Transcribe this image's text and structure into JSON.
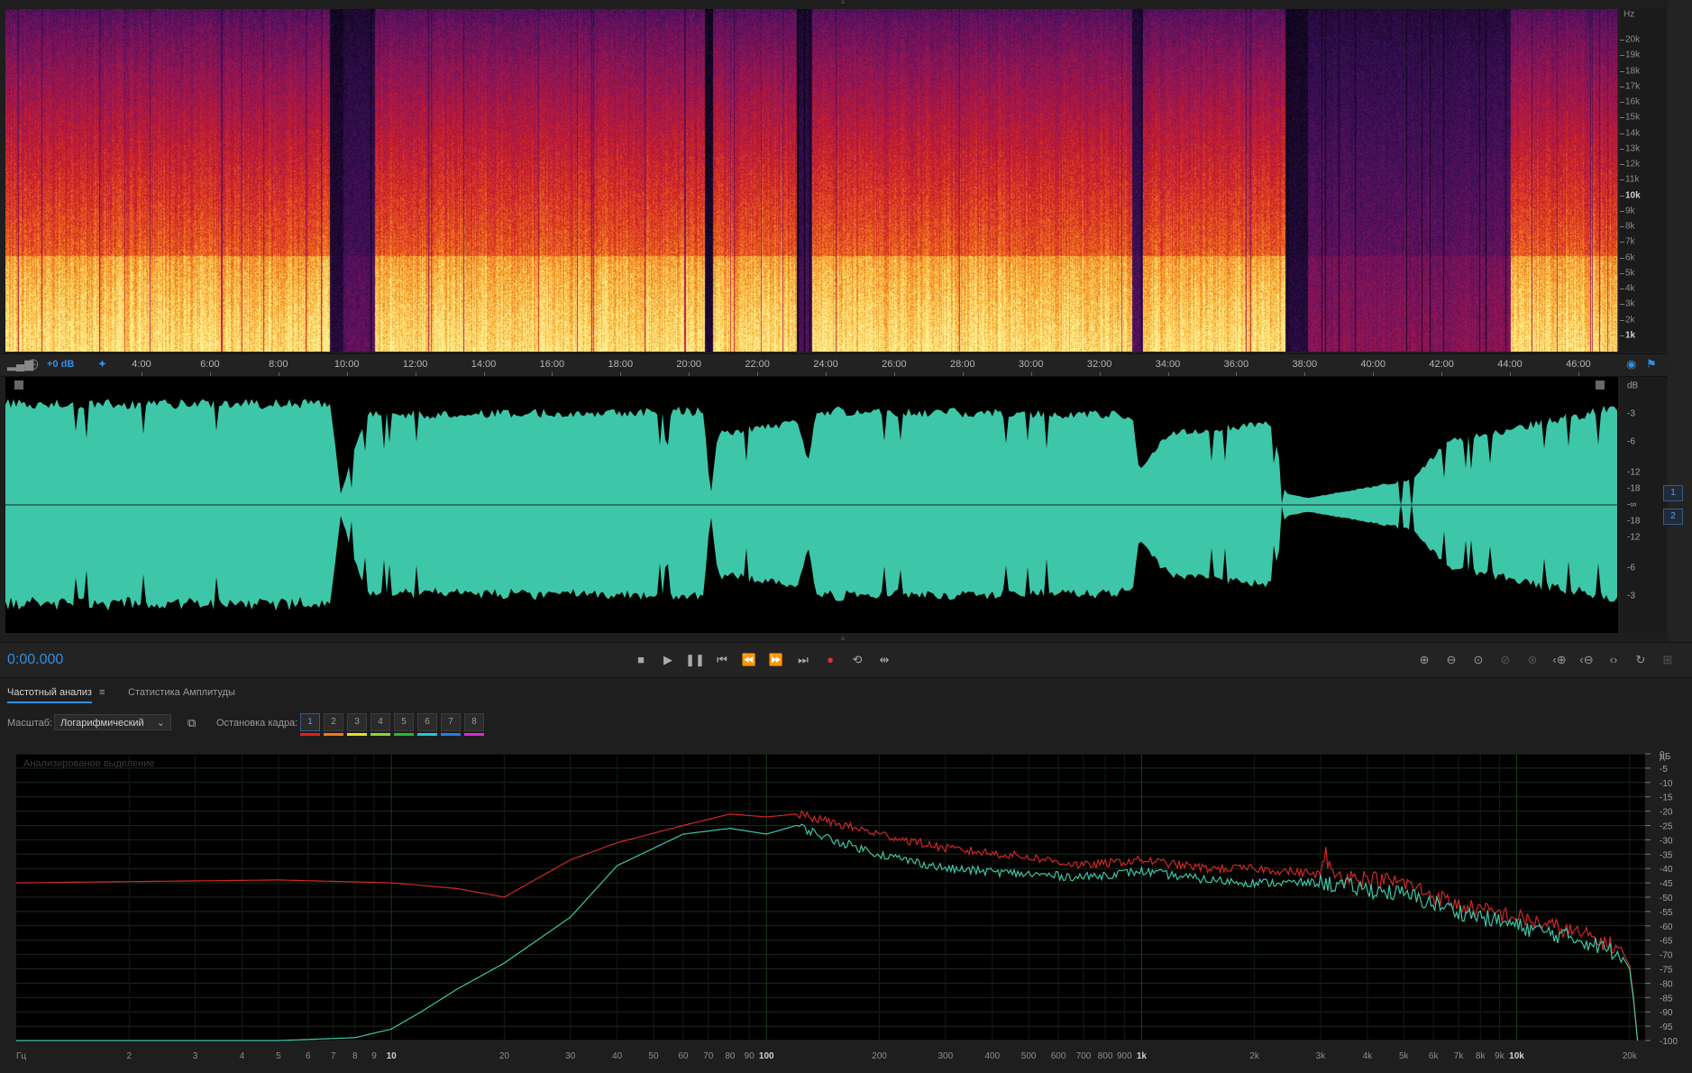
{
  "spectrogram": {
    "unit": "Hz",
    "freq_labels": [
      "20k",
      "19k",
      "18k",
      "17k",
      "16k",
      "15k",
      "14k",
      "13k",
      "12k",
      "11k",
      "10k",
      "9k",
      "8k",
      "7k",
      "6k",
      "5k",
      "4k",
      "3k",
      "2k",
      "1k"
    ]
  },
  "time_ruler": {
    "db_readout": "+0 dB",
    "labels": [
      "4:00",
      "6:00",
      "8:00",
      "10:00",
      "12:00",
      "14:00",
      "16:00",
      "18:00",
      "20:00",
      "22:00",
      "24:00",
      "26:00",
      "28:00",
      "30:00",
      "32:00",
      "34:00",
      "36:00",
      "38:00",
      "40:00",
      "42:00",
      "44:00",
      "46:00"
    ]
  },
  "waveform": {
    "unit": "dB",
    "db_labels": [
      "-3",
      "-6",
      "-12",
      "-18",
      "-∞",
      "-18",
      "-12",
      "-6",
      "-3"
    ],
    "channels": [
      "1",
      "2"
    ],
    "color": "#3ec6a8",
    "peak_color": "#4a6ad8"
  },
  "transport": {
    "timecode": "0:00.000",
    "buttons": [
      "stop",
      "play",
      "pause",
      "go-to-start",
      "rewind",
      "fast-forward",
      "go-to-end",
      "record",
      "loop",
      "skip-selection"
    ]
  },
  "panel": {
    "tabs": [
      {
        "label": "Частотный анализ",
        "active": true
      },
      {
        "label": "Статистика Амплитуды",
        "active": false
      }
    ],
    "scale_label": "Масштаб:",
    "scale_value": "Логарифмический",
    "freeze_label": "Остановка кадра:",
    "frames": [
      {
        "label": "1",
        "color": "#e02020"
      },
      {
        "label": "2",
        "color": "#f07a1a"
      },
      {
        "label": "3",
        "color": "#e8e020"
      },
      {
        "label": "4",
        "color": "#8ad82a"
      },
      {
        "label": "5",
        "color": "#2ab830"
      },
      {
        "label": "6",
        "color": "#20c8d8"
      },
      {
        "label": "7",
        "color": "#2a7ae8"
      },
      {
        "label": "8",
        "color": "#d82ad8"
      }
    ]
  },
  "chart_data": {
    "type": "line",
    "title": "Анализированое выделение",
    "xlabel": "Гц",
    "ylabel": "дБ",
    "xscale": "log",
    "xlim": [
      1,
      22000
    ],
    "ylim": [
      -100,
      0
    ],
    "x_ticks": [
      {
        "v": 2,
        "t": "2"
      },
      {
        "v": 3,
        "t": "3"
      },
      {
        "v": 4,
        "t": "4"
      },
      {
        "v": 5,
        "t": "5"
      },
      {
        "v": 6,
        "t": "6"
      },
      {
        "v": 7,
        "t": "7"
      },
      {
        "v": 8,
        "t": "8"
      },
      {
        "v": 9,
        "t": "9"
      },
      {
        "v": 10,
        "t": "10",
        "bold": true
      },
      {
        "v": 20,
        "t": "20"
      },
      {
        "v": 30,
        "t": "30"
      },
      {
        "v": 40,
        "t": "40"
      },
      {
        "v": 50,
        "t": "50"
      },
      {
        "v": 60,
        "t": "60"
      },
      {
        "v": 70,
        "t": "70"
      },
      {
        "v": 80,
        "t": "80"
      },
      {
        "v": 90,
        "t": "90"
      },
      {
        "v": 100,
        "t": "100",
        "bold": true
      },
      {
        "v": 200,
        "t": "200"
      },
      {
        "v": 300,
        "t": "300"
      },
      {
        "v": 400,
        "t": "400"
      },
      {
        "v": 500,
        "t": "500"
      },
      {
        "v": 600,
        "t": "600"
      },
      {
        "v": 700,
        "t": "700"
      },
      {
        "v": 800,
        "t": "800"
      },
      {
        "v": 900,
        "t": "900"
      },
      {
        "v": 1000,
        "t": "1k",
        "bold": true
      },
      {
        "v": 2000,
        "t": "2k"
      },
      {
        "v": 3000,
        "t": "3k"
      },
      {
        "v": 4000,
        "t": "4k"
      },
      {
        "v": 5000,
        "t": "5k"
      },
      {
        "v": 6000,
        "t": "6k"
      },
      {
        "v": 7000,
        "t": "7k"
      },
      {
        "v": 8000,
        "t": "8k"
      },
      {
        "v": 9000,
        "t": "9k"
      },
      {
        "v": 10000,
        "t": "10k",
        "bold": true
      },
      {
        "v": 20000,
        "t": "20k"
      }
    ],
    "y_ticks": [
      "0",
      "-5",
      "-10",
      "-15",
      "-20",
      "-25",
      "-30",
      "-35",
      "-40",
      "-45",
      "-50",
      "-55",
      "-60",
      "-65",
      "-70",
      "-75",
      "-80",
      "-85",
      "-90",
      "-95",
      "-100"
    ],
    "grid": true,
    "series": [
      {
        "color": "#d02828",
        "x": [
          1,
          5,
          10,
          15,
          20,
          30,
          40,
          60,
          80,
          100,
          120,
          150,
          200,
          300,
          500,
          700,
          1000,
          1500,
          2000,
          3000,
          3100,
          3200,
          5000,
          7000,
          10000,
          15000,
          19000,
          20000,
          20500,
          21000
        ],
        "y": [
          -45,
          -44,
          -45,
          -47,
          -50,
          -37,
          -31,
          -25,
          -21,
          -22,
          -21,
          -24,
          -28,
          -33,
          -36,
          -39,
          -37,
          -40,
          -40,
          -42,
          -35,
          -42,
          -45,
          -53,
          -57,
          -63,
          -68,
          -74,
          -85,
          -100
        ]
      },
      {
        "color": "#3ec6a8",
        "x": [
          1,
          5,
          8,
          10,
          12,
          15,
          20,
          30,
          40,
          60,
          80,
          100,
          120,
          150,
          200,
          300,
          500,
          700,
          1000,
          1500,
          2000,
          3000,
          5000,
          7000,
          10000,
          15000,
          19000,
          20000,
          20500,
          21000
        ],
        "y": [
          -100,
          -100,
          -99,
          -96,
          -90,
          -82,
          -73,
          -57,
          -39,
          -28,
          -26,
          -28,
          -25,
          -30,
          -35,
          -40,
          -42,
          -43,
          -41,
          -44,
          -45,
          -45,
          -49,
          -55,
          -60,
          -65,
          -70,
          -75,
          -86,
          -100
        ]
      }
    ]
  }
}
